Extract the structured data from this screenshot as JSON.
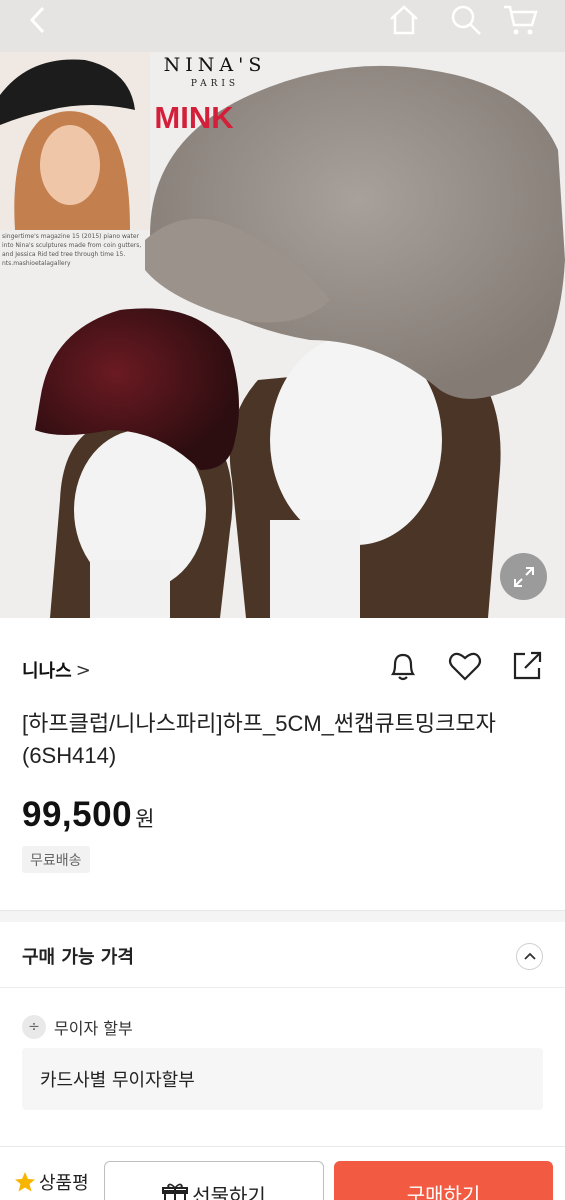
{
  "hero": {
    "brand_logo": "NINA'S",
    "brand_sub": "PARIS",
    "brand_mink": "MINK",
    "inset_caption": "singertime's magazine 15 (2015) piano water into Nina's sculptures made from coin gutters, and Jessica Rid ted tree through time 15. nts.mashioetalagallery"
  },
  "seller": {
    "name": "니나스",
    "chevron": ">"
  },
  "product": {
    "title": "[하프클럽/니나스파리]하프_5CM_썬캡큐트밍크모자(6SH414)",
    "price": "99,500",
    "price_unit": "원",
    "shipping_badge": "무료배송"
  },
  "purchase_section": {
    "title": "구매 가능 가격",
    "installment_label": "무이자 할부",
    "card_installment": "카드사별 무이자할부"
  },
  "bottom_bar": {
    "review_label": "상품평",
    "gift_label": "선물하기",
    "buy_label": "구매하기"
  },
  "colors": {
    "accent": "#f35a42",
    "brand_red": "#d41f3a"
  },
  "icons": [
    "back-arrow-icon",
    "home-icon",
    "search-icon",
    "cart-icon",
    "expand-icon",
    "bell-icon",
    "heart-icon",
    "share-icon",
    "chevron-up-icon",
    "divide-icon",
    "star-icon",
    "gift-icon"
  ]
}
